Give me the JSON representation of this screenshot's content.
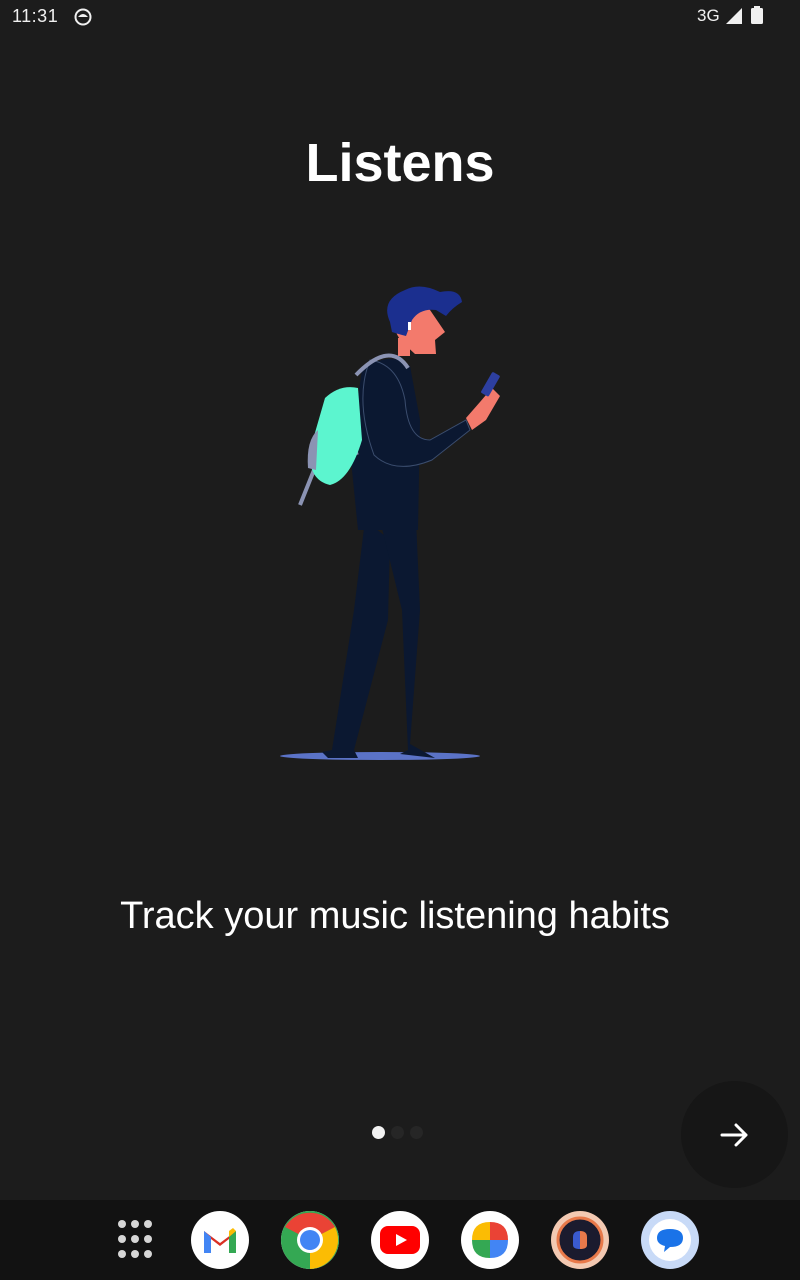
{
  "status_bar": {
    "time": "11:31",
    "network": "3G",
    "icons": [
      "notification-app-icon",
      "signal-icon",
      "battery-icon"
    ]
  },
  "onboarding": {
    "title": "Listens",
    "subtitle": "Track your music listening habits",
    "page_indicator": {
      "current": 1,
      "total": 3
    },
    "next_button_icon": "arrow-right-icon",
    "illustration": "person-with-backpack-looking-at-phone"
  },
  "dock": {
    "items": [
      {
        "name": "app-drawer",
        "icon": "grid-icon"
      },
      {
        "name": "gmail",
        "icon": "gmail-icon"
      },
      {
        "name": "chrome",
        "icon": "chrome-icon"
      },
      {
        "name": "youtube",
        "icon": "youtube-icon"
      },
      {
        "name": "photos",
        "icon": "photos-icon"
      },
      {
        "name": "app-orange",
        "icon": "app-icon"
      },
      {
        "name": "messages",
        "icon": "messages-icon"
      }
    ]
  },
  "colors": {
    "background": "#1c1c1c",
    "text": "#ffffff",
    "backpack": "#5cf5cf",
    "figure": "#0b1831",
    "hair": "#1b2f8f",
    "skin": "#f37a6c"
  }
}
